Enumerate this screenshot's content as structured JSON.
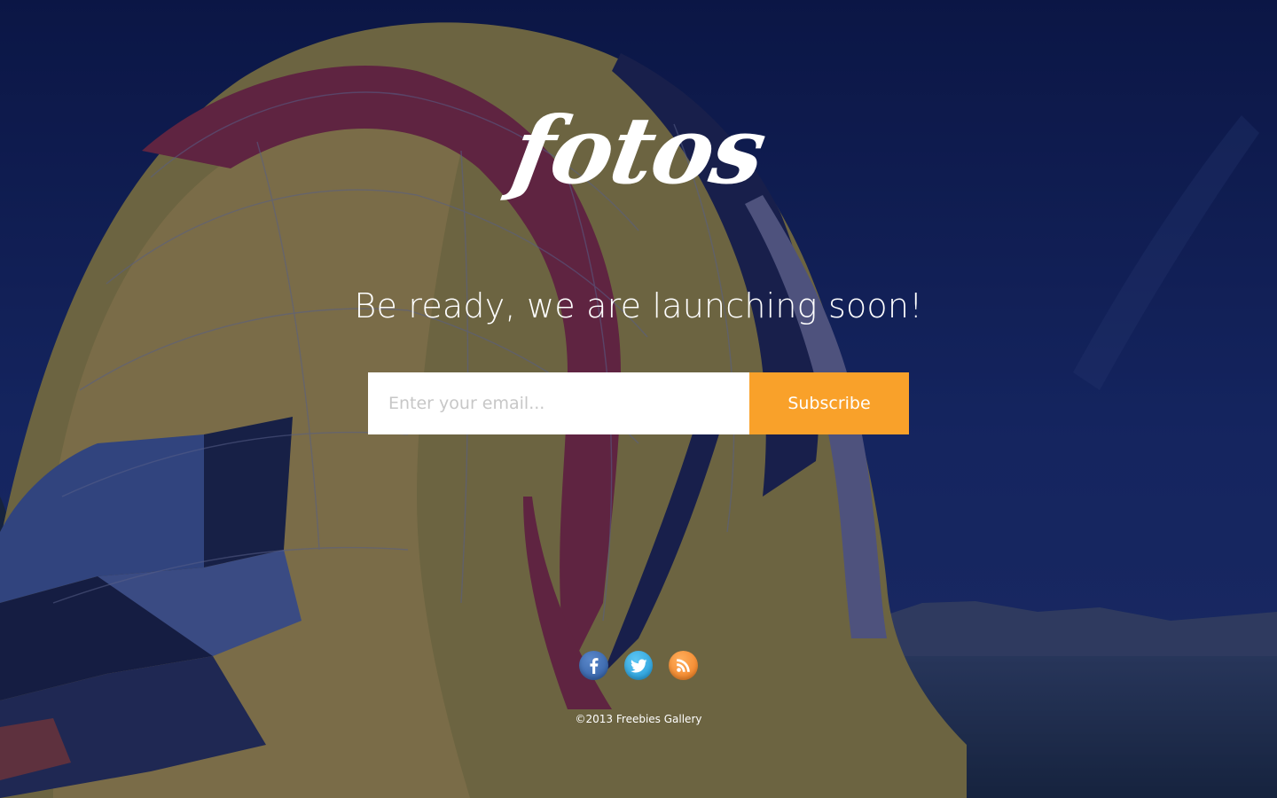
{
  "brand": {
    "logo_text": "fotos"
  },
  "hero": {
    "tagline": "Be ready, we are launching soon!"
  },
  "signup": {
    "email_placeholder": "Enter your email...",
    "email_value": "",
    "subscribe_label": "Subscribe"
  },
  "social": [
    {
      "name": "facebook",
      "icon": "facebook-icon",
      "color": "#3b66ad"
    },
    {
      "name": "twitter",
      "icon": "twitter-icon",
      "color": "#2aa7e3"
    },
    {
      "name": "rss",
      "icon": "rss-icon",
      "color": "#f58a2b"
    }
  ],
  "footer": {
    "copyright": "©2013 Freebies Gallery"
  },
  "colors": {
    "accent": "#f9a12a",
    "overlay": "#0f1a45",
    "text": "#ffffff"
  }
}
